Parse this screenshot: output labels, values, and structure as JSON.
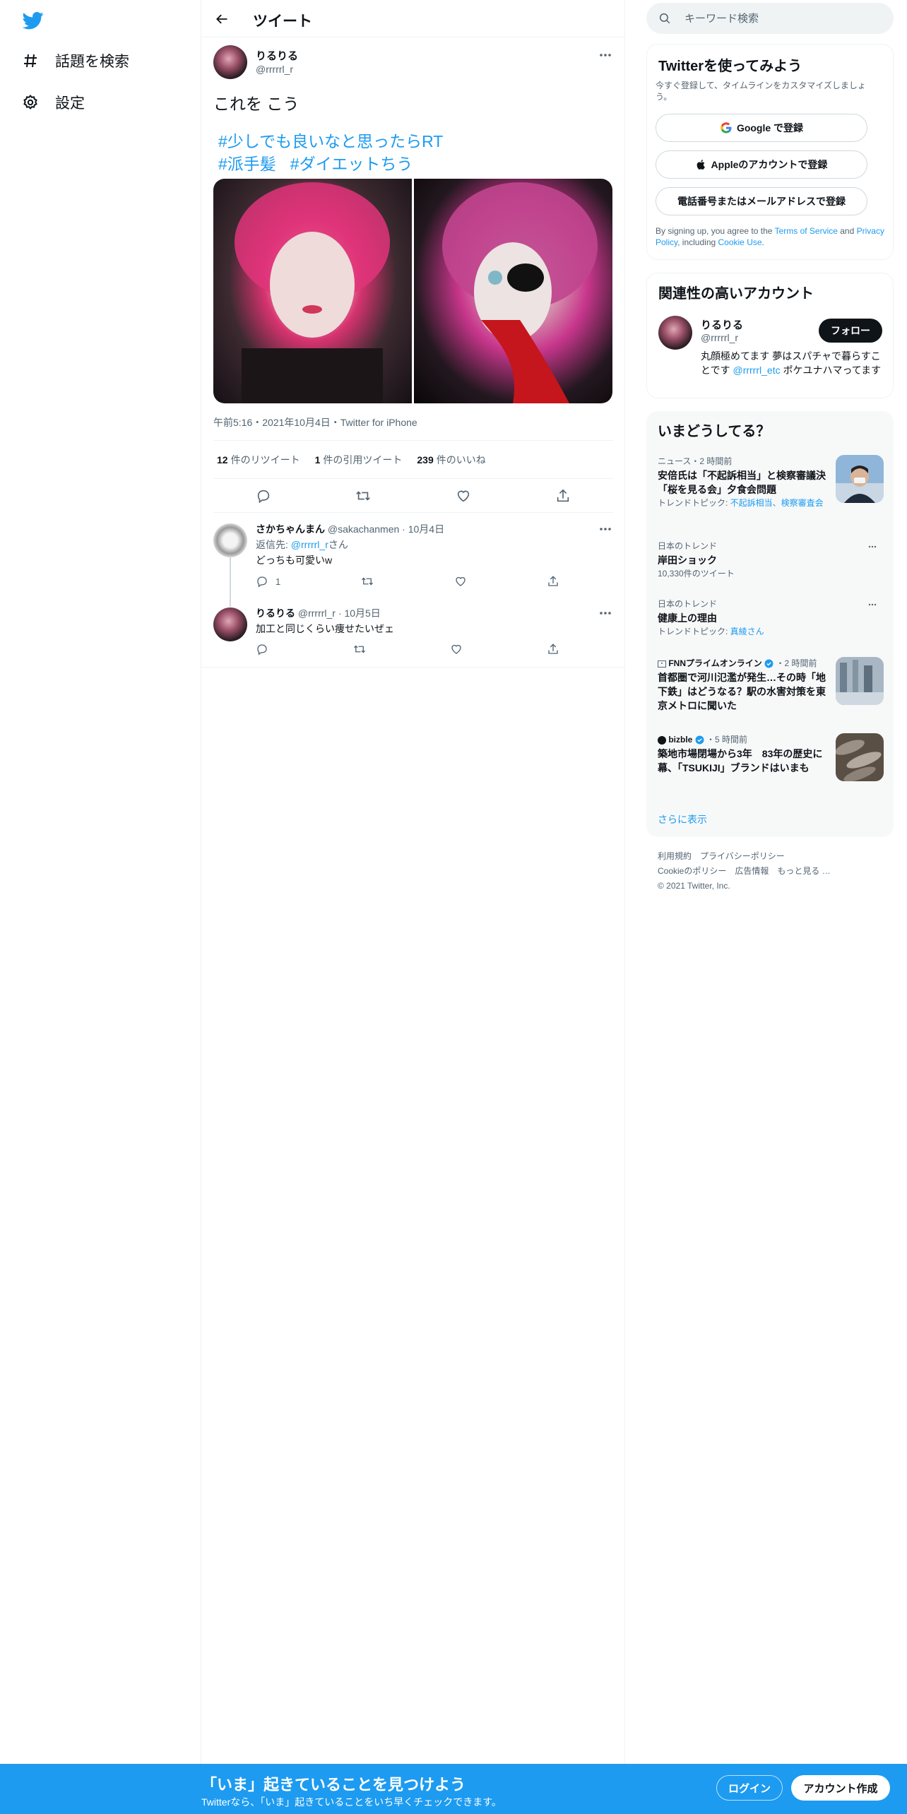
{
  "nav": {
    "explore_label": "話題を検索",
    "settings_label": "設定"
  },
  "header": {
    "title": "ツイート"
  },
  "tweet": {
    "name": "りるりる",
    "handle": "@rrrrrl_r",
    "text": "これを こう",
    "hashtags": [
      "#少しでも良いなと思ったらRT",
      "#派手髪",
      "#ダイエットちう"
    ],
    "meta": "午前5:16・2021年10月4日・Twitter for iPhone",
    "retweets_count": "12",
    "retweets_label": "件のリツイート",
    "quotes_count": "1",
    "quotes_label": "件の引用ツイート",
    "likes_count": "239",
    "likes_label": "件のいいね"
  },
  "replies": [
    {
      "name": "さかちゃんまん",
      "handle": "@sakachanmen",
      "date": "10月4日",
      "reply_to_prefix": "返信先: ",
      "reply_to_handle": "@rrrrrl_r",
      "reply_to_suffix": "さん",
      "text": "どっちも可愛いw",
      "reply_count": "1"
    },
    {
      "name": "りるりる",
      "handle": "@rrrrrl_r",
      "date": "10月5日",
      "text": "加工と同じくらい痩せたいぜェ"
    }
  ],
  "search": {
    "placeholder": "キーワード検索"
  },
  "signup": {
    "title": "Twitterを使ってみよう",
    "subtitle": "今すぐ登録して、タイムラインをカスタマイズしましょう。",
    "google_label": "Google で登録",
    "apple_label": "Appleのアカウントで登録",
    "phone_label": "電話番号またはメールアドレスで登録",
    "tos_prefix": "By signing up, you agree to the ",
    "tos_link": "Terms of Service",
    "tos_and": " and ",
    "privacy_link": "Privacy Policy",
    "tos_including": ", including ",
    "cookie_link": "Cookie Use",
    "tos_end": "."
  },
  "related": {
    "title": "関連性の高いアカウント",
    "name": "りるりる",
    "handle": "@rrrrrl_r",
    "follow_label": "フォロー",
    "bio_prefix": "丸顔極めてます 夢はスパチャで暮らすことです ",
    "bio_mention": "@rrrrrl_etc",
    "bio_suffix": " ポケユナハマってます"
  },
  "trends": {
    "title": "いまどうしてる？",
    "items": [
      {
        "meta": "ニュース・2 時間前",
        "title": "安倍氏は「不起訴相当」と検察審議決 「桜を見る会」夕食会問題",
        "sub_prefix": "トレンドトピック: ",
        "sub_link": "不起訴相当、検察審査会"
      },
      {
        "meta": "日本のトレンド",
        "title": "岸田ショック",
        "sub": "10,330件のツイート"
      },
      {
        "meta": "日本のトレンド",
        "title": "健康上の理由",
        "sub_prefix": "トレンドトピック: ",
        "sub_link": "真綾さん"
      },
      {
        "source": "FNNプライムオンライン",
        "time": "・2 時間前",
        "title": "首都圏で河川氾濫が発生…その時「地下鉄」はどうなる？駅の水害対策を東京メトロに聞いた"
      },
      {
        "source": "bizble",
        "time": "・5 時間前",
        "title": "築地市場閉場から3年　83年の歴史に幕、「TSUKIJI」ブランドはいまも"
      }
    ],
    "show_more": "さらに表示"
  },
  "footer": {
    "links": [
      "利用規約",
      "プライバシーポリシー",
      "Cookieのポリシー",
      "広告情報",
      "もっと見る …"
    ],
    "copyright": "© 2021 Twitter, Inc."
  },
  "bottom_bar": {
    "title": "「いま」起きていることを見つけよう",
    "subtitle": "Twitterなら、「いま」起きていることをいち早くチェックできます。",
    "login_label": "ログイン",
    "signup_label": "アカウント作成"
  },
  "colors": {
    "accent": "#1d9bf0",
    "text": "#0f1419",
    "muted": "#536471"
  }
}
